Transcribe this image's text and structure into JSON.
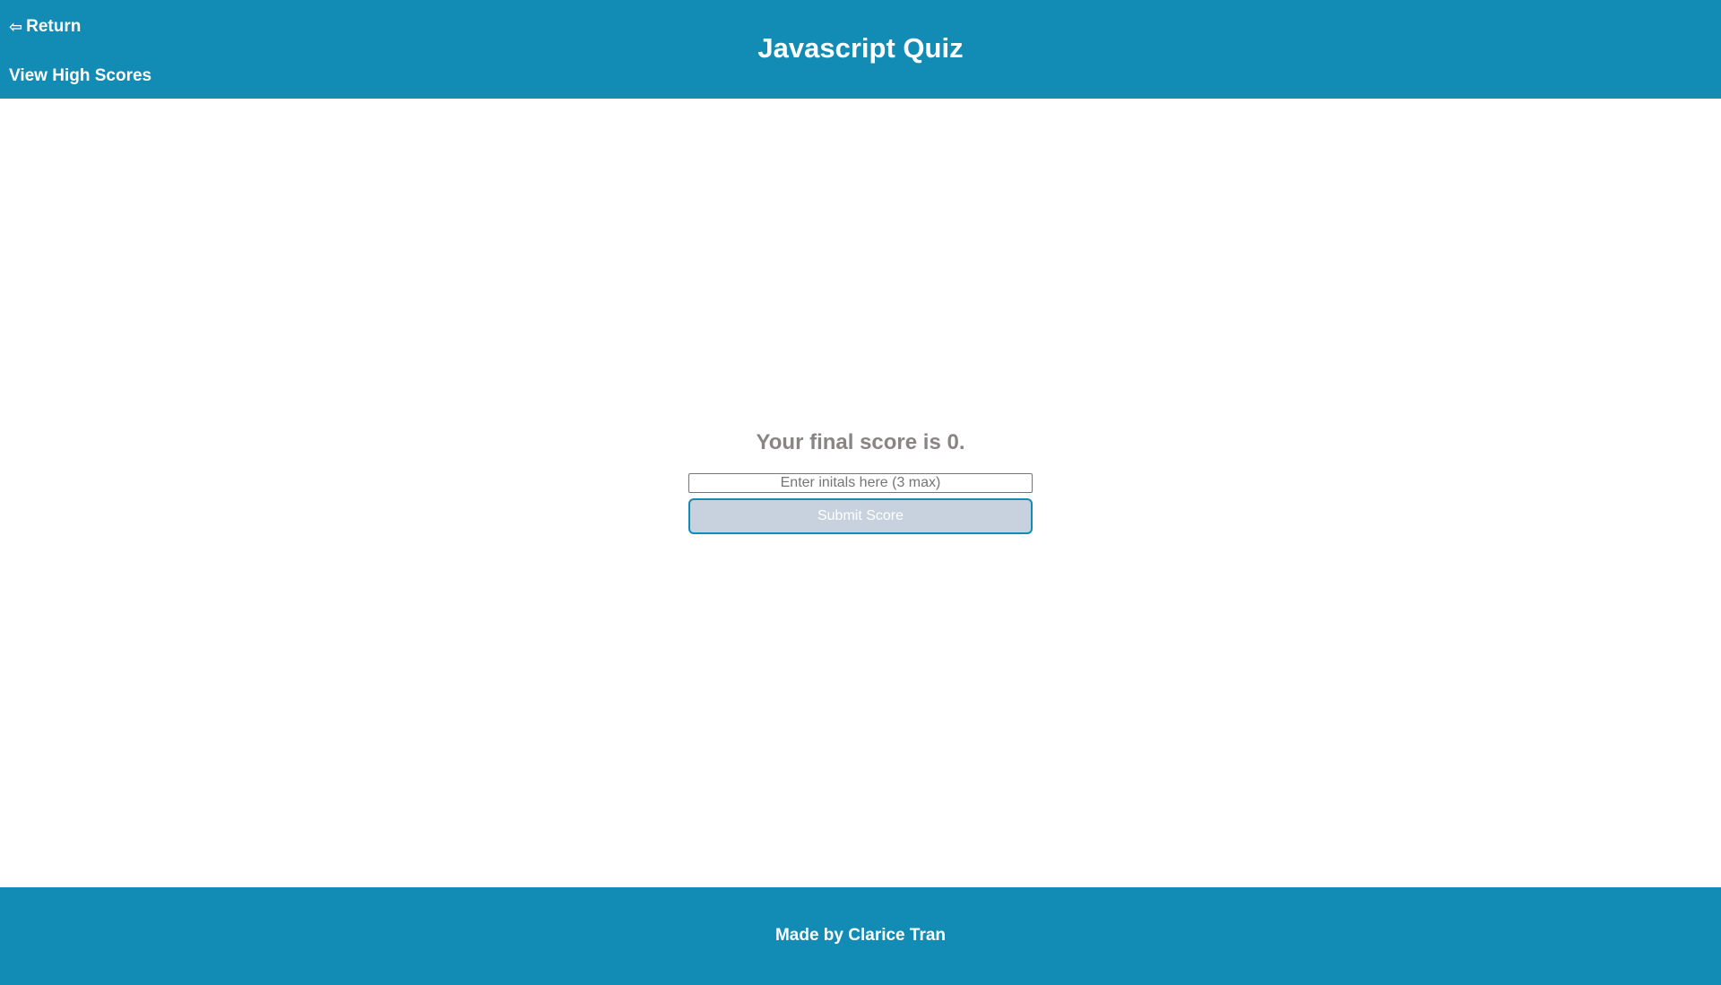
{
  "header": {
    "return_arrow": "⇦",
    "return_label": "Return",
    "high_scores_label": "View High Scores",
    "title": "Javascript Quiz"
  },
  "main": {
    "score_text": "Your final score is 0.",
    "initials_placeholder": "Enter initals here (3 max)",
    "initials_value": "",
    "submit_label": "Submit Score"
  },
  "footer": {
    "credit": "Made by Clarice Tran"
  },
  "colors": {
    "brand": "#128bb5",
    "score_text": "#8a8484",
    "submit_bg": "#c8d2de"
  }
}
